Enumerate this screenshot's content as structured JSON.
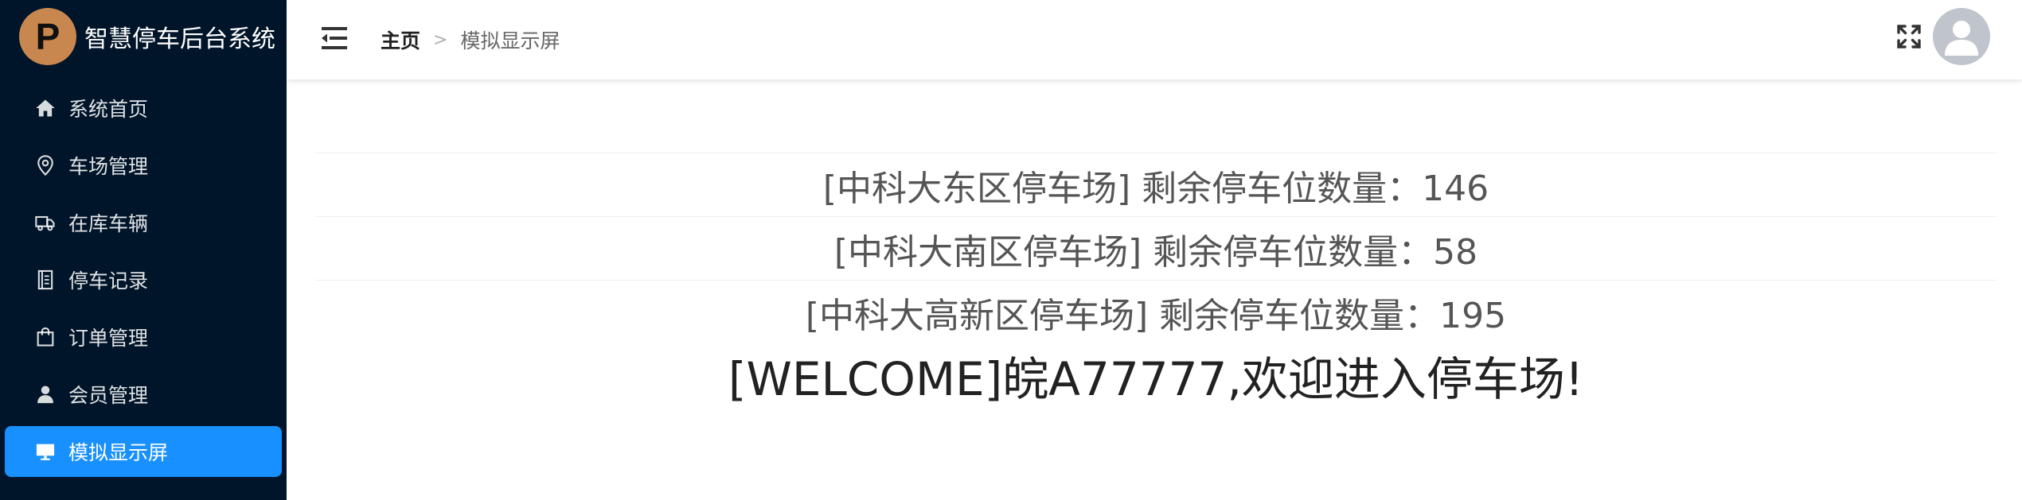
{
  "app": {
    "logo_letter": "P",
    "title": "智慧停车后台系统"
  },
  "sidebar": {
    "items": [
      {
        "label": "系统首页",
        "icon": "home-icon",
        "active": false
      },
      {
        "label": "车场管理",
        "icon": "location-pin-icon",
        "active": false
      },
      {
        "label": "在库车辆",
        "icon": "truck-icon",
        "active": false
      },
      {
        "label": "停车记录",
        "icon": "notebook-icon",
        "active": false
      },
      {
        "label": "订单管理",
        "icon": "shopping-bag-icon",
        "active": false
      },
      {
        "label": "会员管理",
        "icon": "user-icon",
        "active": false
      },
      {
        "label": "模拟显示屏",
        "icon": "monitor-icon",
        "active": true
      }
    ]
  },
  "header": {
    "breadcrumb": {
      "home": "主页",
      "separator": ">",
      "current": "模拟显示屏"
    }
  },
  "display": {
    "lots": [
      {
        "text": "[中科大东区停车场] 剩余停车位数量：146"
      },
      {
        "text": "[中科大南区停车场] 剩余停车位数量：58"
      },
      {
        "text": "[中科大高新区停车场] 剩余停车位数量：195"
      }
    ],
    "welcome": "[WELCOME]皖A77777,欢迎进入停车场!"
  },
  "colors": {
    "sidebar_bg": "#001529",
    "active_item": "#1890ff",
    "logo_bg": "#c8874e",
    "avatar_bg": "#c0c4cc"
  }
}
